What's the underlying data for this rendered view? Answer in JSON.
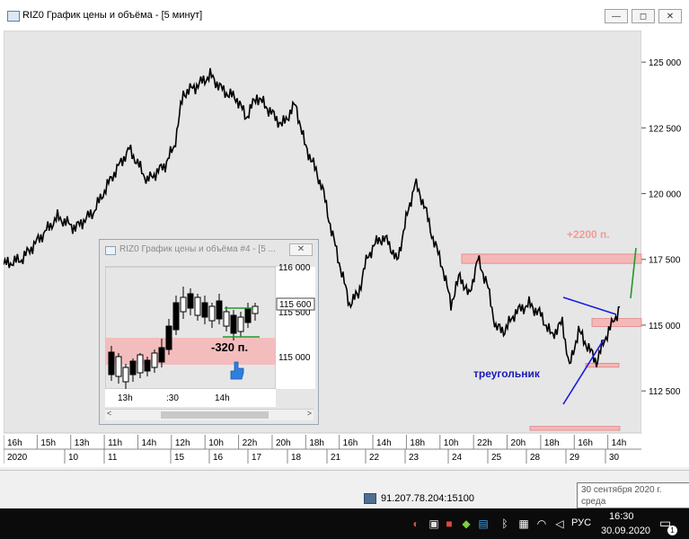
{
  "window": {
    "title": "RIZ0 График цены и объёма - [5 минут]",
    "minimize_label": "—",
    "maximize_label": "◻",
    "close_label": "✕"
  },
  "chart_data": {
    "type": "candlestick",
    "price_axis": {
      "ticks": [
        "125 000",
        "122 500",
        "120 000",
        "117 500",
        "115 000",
        "112 500"
      ],
      "ylim": [
        110900,
        126200
      ]
    },
    "time_axis": {
      "ticks": [
        "16h",
        "15h",
        "13h",
        "11h",
        "14h",
        "12h",
        "10h",
        "22h",
        "20h",
        "18h",
        "16h",
        "14h",
        "18h",
        "10h",
        "22h",
        "20h",
        "18h",
        "16h",
        "14h"
      ],
      "dates": [
        "2020",
        "10",
        "11",
        "15",
        "16",
        "17",
        "18",
        "21",
        "22",
        "23",
        "24",
        "25",
        "28",
        "29",
        "30"
      ]
    },
    "price_path": [
      [
        0,
        117.3
      ],
      [
        20,
        117.5
      ],
      [
        40,
        118.3
      ],
      [
        60,
        119.1
      ],
      [
        80,
        118.7
      ],
      [
        100,
        119.3
      ],
      [
        120,
        120.6
      ],
      [
        140,
        121.7
      ],
      [
        160,
        120.5
      ],
      [
        180,
        121.1
      ],
      [
        190,
        121.8
      ],
      [
        200,
        123.8
      ],
      [
        215,
        124.1
      ],
      [
        230,
        124.5
      ],
      [
        245,
        123.9
      ],
      [
        260,
        123.6
      ],
      [
        270,
        122.9
      ],
      [
        282,
        123.7
      ],
      [
        295,
        123.2
      ],
      [
        310,
        122.6
      ],
      [
        325,
        123.4
      ],
      [
        335,
        121.9
      ],
      [
        345,
        121.1
      ],
      [
        355,
        120.2
      ],
      [
        365,
        118.6
      ],
      [
        375,
        117.2
      ],
      [
        385,
        115.8
      ],
      [
        395,
        116.2
      ],
      [
        405,
        117.6
      ],
      [
        418,
        118.3
      ],
      [
        428,
        118.2
      ],
      [
        438,
        117.4
      ],
      [
        448,
        119.0
      ],
      [
        458,
        120.4
      ],
      [
        468,
        119.6
      ],
      [
        478,
        118.3
      ],
      [
        488,
        117.3
      ],
      [
        498,
        115.8
      ],
      [
        508,
        116.9
      ],
      [
        518,
        116.1
      ],
      [
        528,
        117.5
      ],
      [
        538,
        116.6
      ],
      [
        548,
        114.9
      ],
      [
        558,
        114.8
      ],
      [
        570,
        115.5
      ],
      [
        585,
        115.8
      ],
      [
        598,
        115.4
      ],
      [
        610,
        114.6
      ],
      [
        622,
        115.1
      ],
      [
        630,
        113.4
      ],
      [
        640,
        114.8
      ],
      [
        650,
        114.2
      ],
      [
        660,
        113.6
      ],
      [
        672,
        114.7
      ],
      [
        680,
        115.2
      ],
      [
        686,
        115.7
      ]
    ],
    "annotations": [
      {
        "type": "text",
        "text": "+2200 п.",
        "color": "#f29a9a"
      },
      {
        "type": "text",
        "text": "треугольник",
        "color": "#1a1ab8"
      },
      {
        "type": "zone",
        "price": [
          117.35,
          117.7
        ],
        "color": "#f4b8b8"
      },
      {
        "type": "zone",
        "price": [
          114.95,
          115.25
        ],
        "color": "#f4b8b8"
      },
      {
        "type": "zone",
        "price": [
          113.4,
          113.55
        ],
        "color": "#f4b8b8"
      },
      {
        "type": "zone",
        "price": [
          111.0,
          111.15
        ],
        "color": "#f4b8b8"
      }
    ]
  },
  "inset": {
    "title": "RIZ0 График цены и объёма #4 - [5 ...",
    "close_label": "✕",
    "price_ticks": [
      "116 000",
      "115 500",
      "115 000"
    ],
    "current_price": "115 600",
    "time_ticks": [
      "13h",
      ":30",
      "14h"
    ],
    "annotation": "-320 п.",
    "annotation_color": "#000000",
    "zone_color": "#f4b8b8"
  },
  "status": {
    "connection": "91.207.78.204:15100"
  },
  "tooltip": {
    "line1": "30 сентября 2020 г.",
    "line2": "среда"
  },
  "taskbar": {
    "language": "РУС",
    "time": "16:30",
    "date": "30.09.2020",
    "notifications": "1"
  }
}
